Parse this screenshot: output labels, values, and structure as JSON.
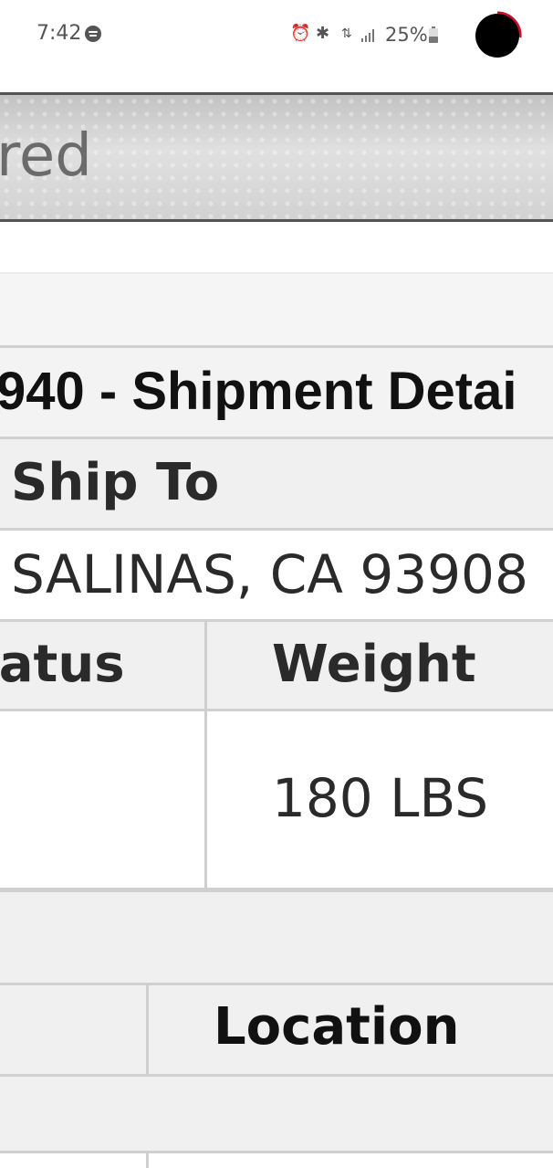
{
  "status_bar": {
    "time": "7:42",
    "battery_percent": "25%",
    "icons": [
      "spotify-icon",
      "alarm-icon",
      "bluetooth-icon",
      "data-arrows-icon",
      "signal-icon",
      "battery-icon",
      "screen-record-icon"
    ]
  },
  "banner": {
    "text": "red"
  },
  "shipment": {
    "title": "940 - Shipment Detai",
    "ship_to_label": "Ship To",
    "ship_to_address": "SALINAS, CA 93908",
    "columns": {
      "status": "tatus",
      "weight": "Weight"
    },
    "weight_value": "180 LBS",
    "location_label": "Location"
  },
  "colors": {
    "record_ring": "#c8102e",
    "banner_border": "#555555",
    "grid_line": "#d0d0d0"
  }
}
